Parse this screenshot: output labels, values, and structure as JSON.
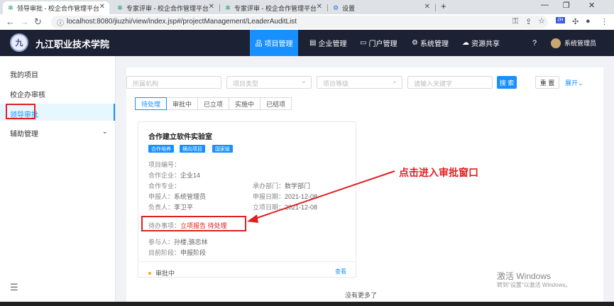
{
  "browser": {
    "tabs": [
      {
        "title": "领导审批 - 校企合作管理平台",
        "active": true
      },
      {
        "title": "专家评审 - 校企合作管理平台",
        "active": false
      },
      {
        "title": "专家评审 - 校企合作管理平台",
        "active": false
      },
      {
        "title": "设置",
        "active": false
      }
    ],
    "new_tab_label": "+",
    "url": "localhost:8080/jiuzhi/view/index.jsp#/projectManagement/LeaderAuditList",
    "profile_badge": "JH"
  },
  "header": {
    "school_name": "九江职业技术学院",
    "logo_text": "九",
    "nav": [
      {
        "label": "项目管理",
        "active": true
      },
      {
        "label": "企业管理",
        "active": false
      },
      {
        "label": "门户管理",
        "active": false
      },
      {
        "label": "系统管理",
        "active": false
      },
      {
        "label": "资源共享",
        "active": false
      }
    ],
    "user_name": "系统管理员"
  },
  "sidebar": {
    "items": [
      {
        "label": "我的项目",
        "active": false
      },
      {
        "label": "校企办审核",
        "active": false
      },
      {
        "label": "领导审批",
        "active": true
      },
      {
        "label": "辅助管理",
        "active": false
      }
    ]
  },
  "filters": {
    "org_placeholder": "所属机构",
    "type_placeholder": "项目类型",
    "level_placeholder": "项目等级",
    "keyword_placeholder": "请输入关键字",
    "search_label": "搜 索",
    "reset_label": "重 置",
    "expand_label": "展开"
  },
  "status_tabs": [
    {
      "label": "待处理",
      "active": true
    },
    {
      "label": "审批中",
      "active": false
    },
    {
      "label": "已立项",
      "active": false
    },
    {
      "label": "实施中",
      "active": false
    },
    {
      "label": "已结项",
      "active": false
    }
  ],
  "card": {
    "title": "合作建立软件实验室",
    "tags": [
      "合作培养",
      "横向项目",
      "国家级"
    ],
    "project_no_label": "项目编号：",
    "partner_label": "合作企业：",
    "partner_value": "企业14",
    "major_label": "合作专业：",
    "dept_label": "承办部门：",
    "dept_value": "数学部门",
    "applicant_label": "申报人：",
    "applicant_value": "系统管理员",
    "apply_date_label": "申报日期：",
    "apply_date_value": "2021-12-08",
    "owner_label": "负责人：",
    "owner_value": "李卫平",
    "setup_date_label": "立项日期：",
    "setup_date_value": "2021-12-08",
    "todo_label": "待办事项：",
    "todo_value": "立项报告 待处理",
    "participants_label": "参与人：",
    "participants_value": "孙楼,骆忠林",
    "stage_label": "目前阶段：",
    "stage_value": "申报阶段",
    "status": "审批中",
    "view_label": "查看"
  },
  "no_more": "没有更多了",
  "annotation": "点击进入审批窗口",
  "watermark": {
    "line1": "激活 Windows",
    "line2": "转到\"设置\"以激活 Windows。"
  },
  "colors": {
    "primary": "#1890ff",
    "header_bg": "#1c2233",
    "annotation_red": "#e02020"
  }
}
